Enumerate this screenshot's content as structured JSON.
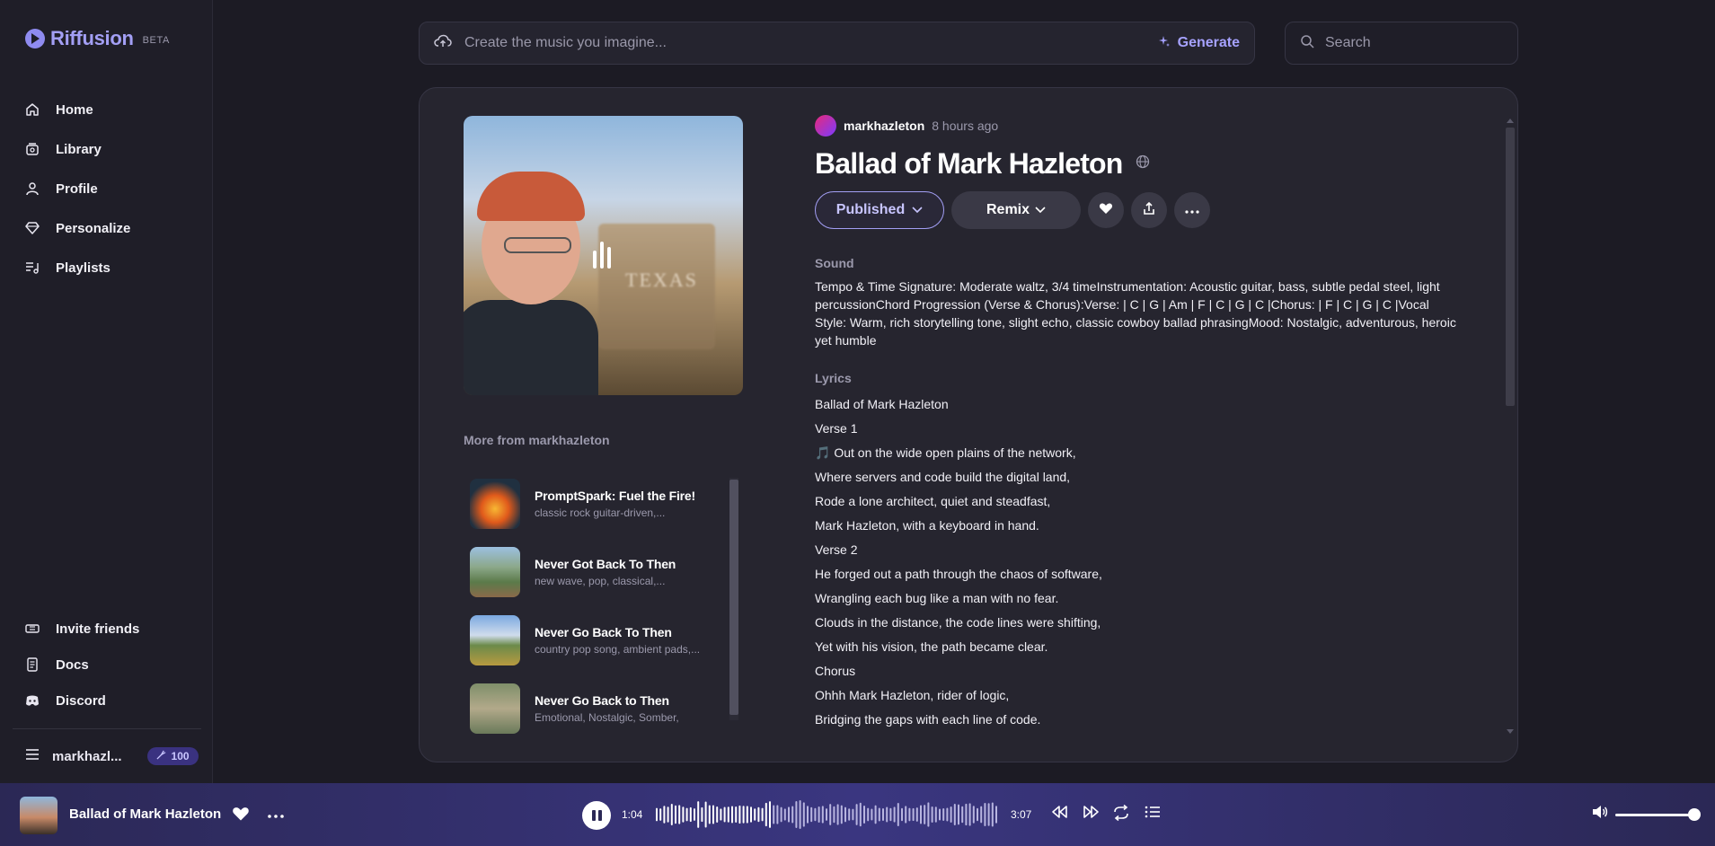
{
  "app": {
    "name": "Riffusion",
    "badge": "BETA"
  },
  "sidebar": {
    "items": [
      {
        "label": "Home",
        "icon": "home-icon"
      },
      {
        "label": "Library",
        "icon": "library-icon"
      },
      {
        "label": "Profile",
        "icon": "user-icon"
      },
      {
        "label": "Personalize",
        "icon": "diamond-icon"
      },
      {
        "label": "Playlists",
        "icon": "playlist-icon"
      }
    ],
    "bottom_items": [
      {
        "label": "Invite friends",
        "icon": "ticket-icon"
      },
      {
        "label": "Docs",
        "icon": "document-icon"
      },
      {
        "label": "Discord",
        "icon": "discord-icon"
      }
    ],
    "user": {
      "name": "markhazl...",
      "credits": "100"
    }
  },
  "topbar": {
    "prompt_placeholder": "Create the music you imagine...",
    "generate_label": "Generate",
    "search_placeholder": "Search"
  },
  "song": {
    "author": "markhazleton",
    "time_ago": "8 hours ago",
    "title": "Ballad of Mark Hazleton",
    "published_label": "Published",
    "remix_label": "Remix",
    "sound_label": "Sound",
    "sound_text": "Tempo & Time Signature: Moderate waltz, 3/4 timeInstrumentation: Acoustic guitar, bass, subtle pedal steel, light percussionChord Progression (Verse & Chorus):Verse: | C | G | Am | F | C | G | C |Chorus: | F | C | G | C |Vocal Style: Warm, rich storytelling tone, slight echo, classic cowboy ballad phrasingMood: Nostalgic, adventurous, heroic yet humble",
    "lyrics_label": "Lyrics",
    "lyrics": [
      "Ballad of Mark Hazleton",
      "Verse 1",
      "🎵 Out on the wide open plains of the network,",
      "Where servers and code build the digital land,",
      "Rode a lone architect, quiet and steadfast,",
      "Mark Hazleton, with a keyboard in hand.",
      "Verse 2",
      "He forged out a path through the chaos of software,",
      "Wrangling each bug like a man with no fear.",
      "Clouds in the distance, the code lines were shifting,",
      "Yet with his vision, the path became clear.",
      "Chorus",
      "Ohhh Mark Hazleton, rider of logic,",
      "Bridging the gaps with each line of code."
    ],
    "cover_sign_text": "TEXAS"
  },
  "more": {
    "title": "More from markhazleton",
    "items": [
      {
        "name": "PromptSpark: Fuel the Fire!",
        "desc": "classic rock guitar-driven,..."
      },
      {
        "name": "Never Got Back To Then",
        "desc": "new wave, pop, classical,..."
      },
      {
        "name": "Never Go Back To Then",
        "desc": "country pop song, ambient pads,..."
      },
      {
        "name": "Never Go Back to Then",
        "desc": "Emotional, Nostalgic, Somber,"
      }
    ]
  },
  "player": {
    "title": "Ballad of Mark Hazleton",
    "current_time": "1:04",
    "total_time": "3:07",
    "progress": 0.34,
    "volume": 0.92
  }
}
